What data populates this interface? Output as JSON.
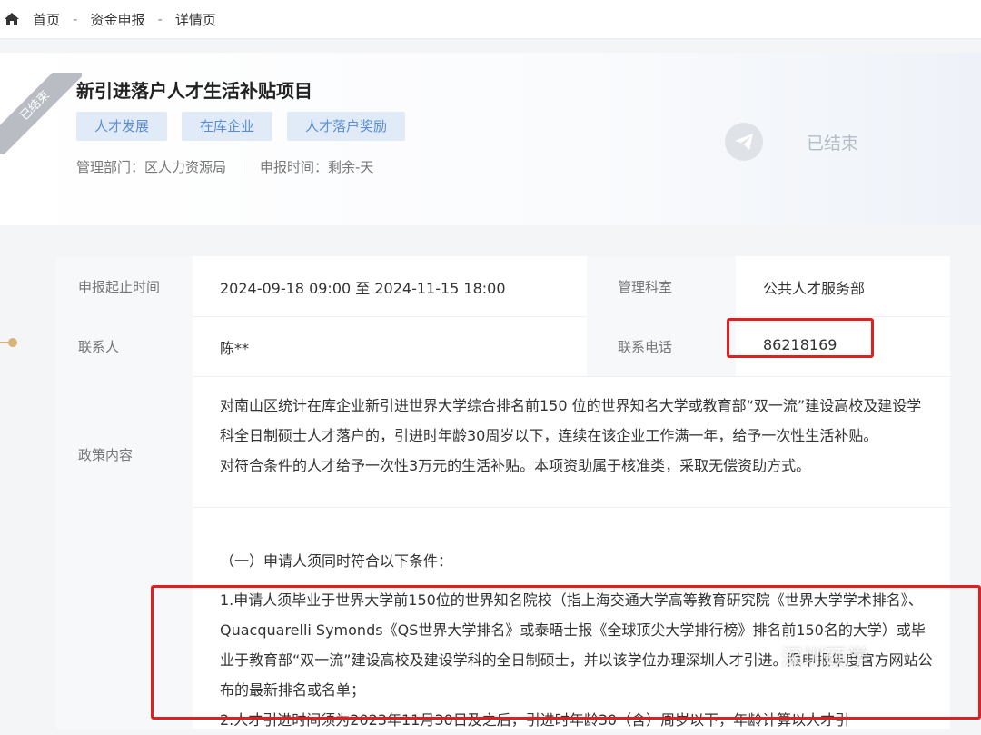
{
  "breadcrumb": {
    "home": "首页",
    "sep": "-",
    "items": [
      "资金申报",
      "详情页"
    ]
  },
  "header": {
    "ribbon": "已结束",
    "title": "新引进落户人才生活补贴项目",
    "tags": [
      "人才发展",
      "在库企业",
      "人才落户奖励"
    ],
    "dept": "管理部门：区人力资源局",
    "apply_time": "申报时间：剩余-天",
    "status": "已结束"
  },
  "details": {
    "period_label": "申报起止时间",
    "period_value": "2024-09-18 09:00 至 2024-11-15 18:00",
    "office_label": "管理科室",
    "office_value": "公共人才服务部",
    "contact_label": "联系人",
    "contact_value": "陈**",
    "phone_label": "联系电话",
    "phone_value": "86218169",
    "policy_label": "政策内容",
    "policy_p1": "对南山区统计在库企业新引进世界大学综合排名前150 位的世界知名大学或教育部“双一流”建设高校及建设学科全日制硕士人才落户的，引进时年龄30周岁以下，连续在该企业工作满一年，给予一次性生活补贴。",
    "policy_p2": "对符合条件的人才给予一次性3万元的生活补贴。本项资助属于核准类，采取无偿资助方式。",
    "cond_title": "（一）申请人须同时符合以下条件：",
    "cond_1": "1.申请人须毕业于世界大学前150位的世界知名院校（指上海交通大学高等教育研究院《世界大学学术排名》、Quacquarelli Symonds《QS世界大学排名》或泰晤士报《全球顶尖大学排行榜》排名前150名的大学）或毕业于教育部“双一流”建设高校及建设学科的全日制硕士，并以该学位办理深圳人才引进。限申报年度官方网站公布的最新排名或名单；",
    "cond_2": "2.人才引进时间须为2023年11月30日及之后，引进时年龄30（含）周岁以下，年龄计算以人才引"
  },
  "watermark": "深圳硕学",
  "colors": {
    "accent": "#5a8ed4",
    "tag_bg": "#e1ebf8",
    "highlight": "#e02020",
    "ribbon": "#b9bdc3"
  }
}
